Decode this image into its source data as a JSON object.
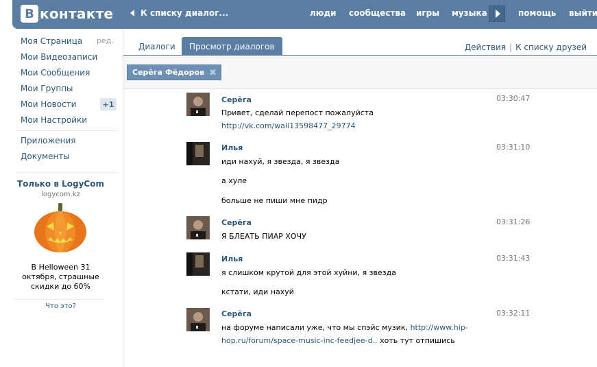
{
  "header": {
    "logo_box": "В",
    "logo_word": "контакте",
    "back_label": "К списку диалог...",
    "nav": [
      "люди",
      "сообщества",
      "игры",
      "музыка",
      "помощь",
      "выйти"
    ]
  },
  "sidebar": {
    "edit": "ред.",
    "links": [
      "Моя Страница",
      "Мои Видеозаписи",
      "Мои Сообщения",
      "Мои Группы",
      "Мои Новости",
      "Мои Настройки"
    ],
    "news_badge": "+1",
    "links2": [
      "Приложения",
      "Документы"
    ],
    "ad": {
      "title": "Только в LogyCom",
      "domain": "logycom.kz",
      "text": "В Helloween 31 октября, страшные скидки до 60%",
      "what": "Что это?"
    }
  },
  "tabs": {
    "items": [
      "Диалоги",
      "Просмотр диалогов"
    ],
    "active": 1,
    "actions": "Действия",
    "friends": "К списку друзей"
  },
  "filter": {
    "chip": "Серёга Фёдоров"
  },
  "messages": [
    {
      "author": "Серёга",
      "time": "03:30:47",
      "lines": [
        "Привет, сделай перепост пожалуйста"
      ],
      "link": "http://vk.com/wall13598477_29774"
    },
    {
      "author": "Илья",
      "time": "03:31:10",
      "lines": [
        "иди нахуй, я звезда, я звезда",
        "а хуле",
        "больше не пиши мне пидр"
      ]
    },
    {
      "author": "Серёга",
      "time": "03:31:26",
      "lines": [
        "Я БЛЕАТЬ ПИАР ХОЧУ"
      ]
    },
    {
      "author": "Илья",
      "time": "03:31:43",
      "lines": [
        "я слишком крутой для этой хуйни, я звезда",
        "кстати, иди нахуй"
      ]
    },
    {
      "author": "Серёга",
      "time": "03:32:11",
      "line1_text": "на форуме написали уже, что мы спэйс музик, ",
      "line1_link": "http://www.hip-",
      "line2_link": "hop.ru/forum/space-music-inc-feedjee-d..",
      "line2_text": " хоть тут отпишись"
    }
  ],
  "colors": {
    "header": "#597da3",
    "link": "#2b587a",
    "chip": "#6d8fb3"
  }
}
